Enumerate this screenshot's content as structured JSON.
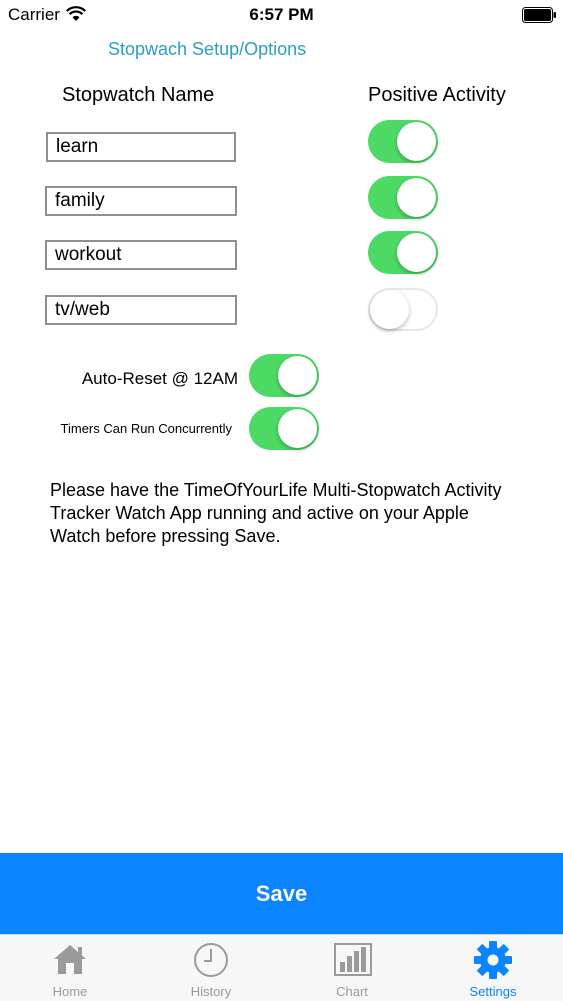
{
  "status_bar": {
    "carrier": "Carrier",
    "time": "6:57 PM"
  },
  "page_title": "Stopwach Setup/Options",
  "columns": {
    "name": "Stopwatch Name",
    "positive": "Positive Activity"
  },
  "stopwatches": [
    {
      "name": "learn",
      "positive": true
    },
    {
      "name": "family",
      "positive": true
    },
    {
      "name": "workout",
      "positive": true
    },
    {
      "name": "tv/web",
      "positive": false
    }
  ],
  "options": {
    "auto_reset": {
      "label": "Auto-Reset @ 12AM",
      "on": true
    },
    "concurrent": {
      "label": "Timers Can Run Concurrently",
      "on": true
    }
  },
  "message": "Please have the TimeOfYourLife Multi-Stopwatch Activity Tracker Watch App running and active on your Apple Watch before pressing Save.",
  "save_label": "Save",
  "tabs": [
    {
      "label": "Home",
      "icon": "home-icon",
      "active": false
    },
    {
      "label": "History",
      "icon": "clock-icon",
      "active": false
    },
    {
      "label": "Chart",
      "icon": "bar-chart-icon",
      "active": false
    },
    {
      "label": "Settings",
      "icon": "gear-icon",
      "active": true
    }
  ],
  "colors": {
    "accent": "#0a84ff",
    "title": "#2a9ec9",
    "toggle_on": "#4cd964"
  }
}
